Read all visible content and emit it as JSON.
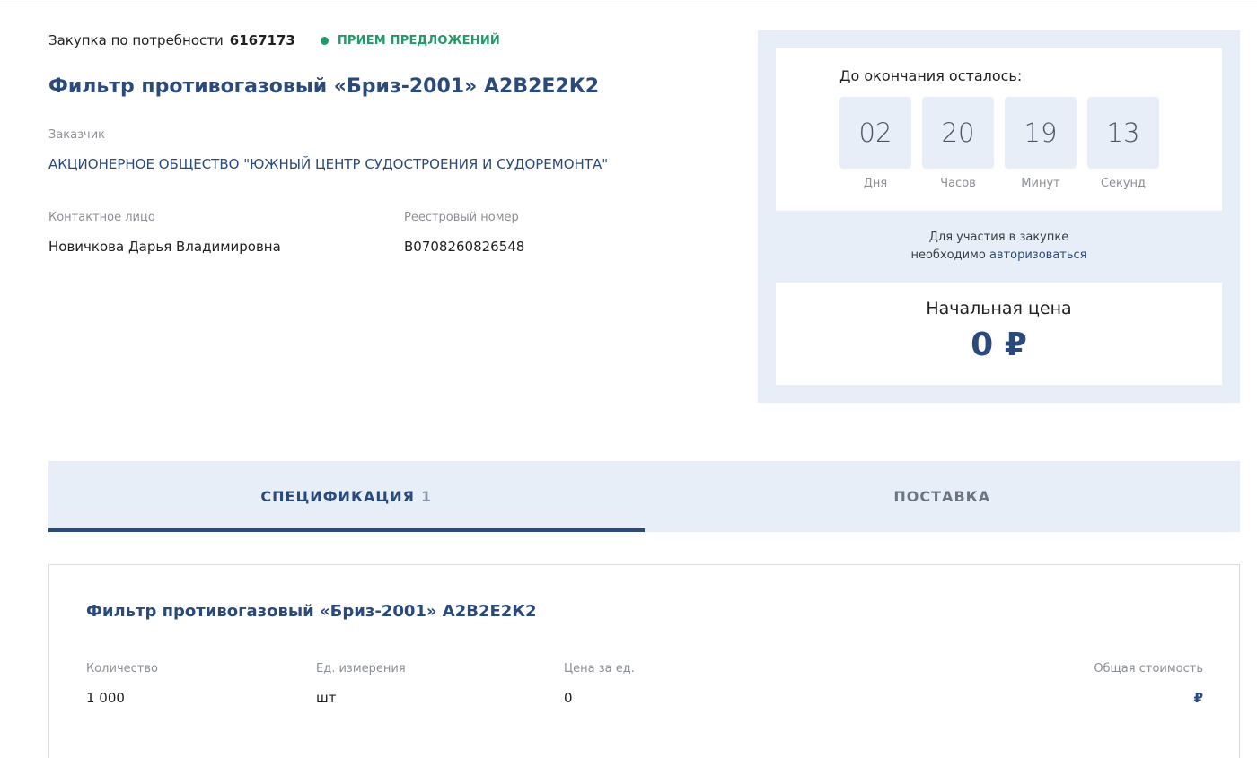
{
  "header": {
    "purchase_label": "Закупка по потребности",
    "purchase_number": "6167173",
    "status": "ПРИЕМ ПРЕДЛОЖЕНИЙ",
    "status_color": "#1f9b67",
    "title": "Фильтр противогазовый «Бриз-2001» А2В2Е2К2"
  },
  "customer": {
    "label": "Заказчик",
    "value": "АКЦИОНЕРНОЕ ОБЩЕСТВО \"ЮЖНЫЙ ЦЕНТР СУДОСТРОЕНИЯ И СУДОРЕМОНТА\""
  },
  "contact": {
    "label": "Контактное лицо",
    "value": "Новичкова Дарья Владимировна"
  },
  "registry": {
    "label": "Реестровый номер",
    "value": "В0708260826548"
  },
  "timer": {
    "title": "До окончания осталось:",
    "days": "02",
    "days_label": "Дня",
    "hours": "20",
    "hours_label": "Часов",
    "minutes": "19",
    "minutes_label": "Минут",
    "seconds": "13",
    "seconds_label": "Секунд"
  },
  "auth": {
    "line1": "Для участия в закупке",
    "line2_prefix": "необходимо",
    "link": "авторизоваться"
  },
  "price": {
    "label": "Начальная цена",
    "value": "0 ₽"
  },
  "tabs": [
    {
      "label": "СПЕЦИФИКАЦИЯ",
      "count": "1",
      "active": true
    },
    {
      "label": "ПОСТАВКА",
      "active": false
    }
  ],
  "spec": {
    "title": "Фильтр противогазовый «Бриз-2001» А2В2Е2К2",
    "quantity_label": "Количество",
    "quantity": "1 000",
    "unit_label": "Ед. измерения",
    "unit": "шт",
    "unit_price_label": "Цена за ед.",
    "unit_price": "0",
    "total_label": "Общая стоимость",
    "total": "₽"
  },
  "colors": {
    "accent": "#2a4a7b",
    "panel_bg": "#e8eef7",
    "status_green": "#1f9b67"
  }
}
